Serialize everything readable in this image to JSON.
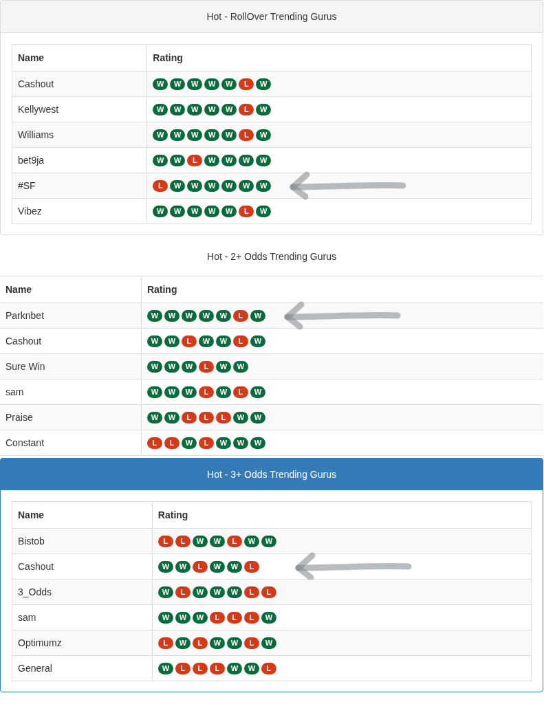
{
  "panels": [
    {
      "title": "Hot - RollOver Trending Gurus",
      "kind": "default",
      "columns": [
        "Name",
        "Rating"
      ],
      "rows": [
        {
          "name": "Cashout",
          "arrow": false,
          "rating": [
            {
              "text": "W",
              "kind": "win"
            },
            {
              "text": "W",
              "kind": "win"
            },
            {
              "text": "W",
              "kind": "win"
            },
            {
              "text": "W",
              "kind": "win"
            },
            {
              "text": "W",
              "kind": "win"
            },
            {
              "text": "L",
              "kind": "loss"
            },
            {
              "text": "W",
              "kind": "win"
            }
          ]
        },
        {
          "name": "Kellywest",
          "arrow": false,
          "rating": [
            {
              "text": "W",
              "kind": "win"
            },
            {
              "text": "W",
              "kind": "win"
            },
            {
              "text": "W",
              "kind": "win"
            },
            {
              "text": "W",
              "kind": "win"
            },
            {
              "text": "W",
              "kind": "win"
            },
            {
              "text": "L",
              "kind": "loss"
            },
            {
              "text": "W",
              "kind": "win"
            }
          ]
        },
        {
          "name": "Williams",
          "arrow": false,
          "rating": [
            {
              "text": "W",
              "kind": "win"
            },
            {
              "text": "W",
              "kind": "win"
            },
            {
              "text": "W",
              "kind": "win"
            },
            {
              "text": "W",
              "kind": "win"
            },
            {
              "text": "W",
              "kind": "win"
            },
            {
              "text": "L",
              "kind": "loss"
            },
            {
              "text": "W",
              "kind": "win"
            }
          ]
        },
        {
          "name": "bet9ja",
          "arrow": false,
          "rating": [
            {
              "text": "W",
              "kind": "win"
            },
            {
              "text": "W",
              "kind": "win"
            },
            {
              "text": "L",
              "kind": "loss"
            },
            {
              "text": "W",
              "kind": "win"
            },
            {
              "text": "W",
              "kind": "win"
            },
            {
              "text": "W",
              "kind": "win"
            },
            {
              "text": "W",
              "kind": "win"
            }
          ]
        },
        {
          "name": "#SF",
          "arrow": true,
          "rating": [
            {
              "text": "L",
              "kind": "loss"
            },
            {
              "text": "W",
              "kind": "win"
            },
            {
              "text": "W",
              "kind": "win"
            },
            {
              "text": "W",
              "kind": "win"
            },
            {
              "text": "W",
              "kind": "win"
            },
            {
              "text": "W",
              "kind": "win"
            },
            {
              "text": "W",
              "kind": "win"
            }
          ]
        },
        {
          "name": "Vibez",
          "arrow": false,
          "rating": [
            {
              "text": "W",
              "kind": "win"
            },
            {
              "text": "W",
              "kind": "win"
            },
            {
              "text": "W",
              "kind": "win"
            },
            {
              "text": "W",
              "kind": "win"
            },
            {
              "text": "W",
              "kind": "win"
            },
            {
              "text": "L",
              "kind": "loss"
            },
            {
              "text": "W",
              "kind": "win"
            }
          ]
        }
      ]
    },
    {
      "title": "Hot - 2+ Odds Trending Gurus",
      "kind": "plain",
      "columns": [
        "Name",
        "Rating"
      ],
      "rows": [
        {
          "name": "Parknbet",
          "arrow": true,
          "rating": [
            {
              "text": "W",
              "kind": "win"
            },
            {
              "text": "W",
              "kind": "win"
            },
            {
              "text": "W",
              "kind": "win"
            },
            {
              "text": "W",
              "kind": "win"
            },
            {
              "text": "W",
              "kind": "win"
            },
            {
              "text": "L",
              "kind": "loss"
            },
            {
              "text": "W",
              "kind": "win"
            }
          ]
        },
        {
          "name": "Cashout",
          "arrow": false,
          "rating": [
            {
              "text": "W",
              "kind": "win"
            },
            {
              "text": "W",
              "kind": "win"
            },
            {
              "text": "L",
              "kind": "loss"
            },
            {
              "text": "W",
              "kind": "win"
            },
            {
              "text": "W",
              "kind": "win"
            },
            {
              "text": "L",
              "kind": "loss"
            },
            {
              "text": "W",
              "kind": "win"
            }
          ]
        },
        {
          "name": "Sure Win",
          "arrow": false,
          "rating": [
            {
              "text": "W",
              "kind": "win"
            },
            {
              "text": "W",
              "kind": "win"
            },
            {
              "text": "W",
              "kind": "win"
            },
            {
              "text": "L",
              "kind": "loss"
            },
            {
              "text": "W",
              "kind": "win"
            },
            {
              "text": "W",
              "kind": "win"
            }
          ]
        },
        {
          "name": "sam",
          "arrow": false,
          "rating": [
            {
              "text": "W",
              "kind": "win"
            },
            {
              "text": "W",
              "kind": "win"
            },
            {
              "text": "W",
              "kind": "win"
            },
            {
              "text": "L",
              "kind": "loss"
            },
            {
              "text": "W",
              "kind": "win"
            },
            {
              "text": "L",
              "kind": "loss"
            },
            {
              "text": "W",
              "kind": "win"
            }
          ]
        },
        {
          "name": "Praise",
          "arrow": false,
          "rating": [
            {
              "text": "W",
              "kind": "win"
            },
            {
              "text": "W",
              "kind": "win"
            },
            {
              "text": "L",
              "kind": "loss"
            },
            {
              "text": "L",
              "kind": "loss"
            },
            {
              "text": "L",
              "kind": "loss"
            },
            {
              "text": "W",
              "kind": "win"
            },
            {
              "text": "W",
              "kind": "win"
            }
          ]
        },
        {
          "name": "Constant",
          "arrow": false,
          "rating": [
            {
              "text": "L",
              "kind": "loss"
            },
            {
              "text": "L",
              "kind": "loss"
            },
            {
              "text": "W",
              "kind": "win"
            },
            {
              "text": "L",
              "kind": "loss"
            },
            {
              "text": "W",
              "kind": "win"
            },
            {
              "text": "W",
              "kind": "win"
            },
            {
              "text": "W",
              "kind": "win"
            }
          ]
        }
      ]
    },
    {
      "title": "Hot - 3+ Odds Trending Gurus",
      "kind": "primary",
      "columns": [
        "Name",
        "Rating"
      ],
      "rows": [
        {
          "name": "Bistob",
          "arrow": false,
          "rating": [
            {
              "text": "L",
              "kind": "loss"
            },
            {
              "text": "L",
              "kind": "loss"
            },
            {
              "text": "W",
              "kind": "win"
            },
            {
              "text": "W",
              "kind": "win"
            },
            {
              "text": "L",
              "kind": "loss"
            },
            {
              "text": "W",
              "kind": "win"
            },
            {
              "text": "W",
              "kind": "win"
            }
          ]
        },
        {
          "name": "Cashout",
          "arrow": true,
          "rating": [
            {
              "text": "W",
              "kind": "win"
            },
            {
              "text": "W",
              "kind": "win"
            },
            {
              "text": "L",
              "kind": "loss"
            },
            {
              "text": "W",
              "kind": "win"
            },
            {
              "text": "W",
              "kind": "win"
            },
            {
              "text": "L",
              "kind": "loss"
            }
          ]
        },
        {
          "name": "3_Odds",
          "arrow": false,
          "rating": [
            {
              "text": "W",
              "kind": "win"
            },
            {
              "text": "L",
              "kind": "loss"
            },
            {
              "text": "W",
              "kind": "win"
            },
            {
              "text": "W",
              "kind": "win"
            },
            {
              "text": "W",
              "kind": "win"
            },
            {
              "text": "L",
              "kind": "loss"
            },
            {
              "text": "L",
              "kind": "loss"
            }
          ]
        },
        {
          "name": "sam",
          "arrow": false,
          "rating": [
            {
              "text": "W",
              "kind": "win"
            },
            {
              "text": "W",
              "kind": "win"
            },
            {
              "text": "W",
              "kind": "win"
            },
            {
              "text": "L",
              "kind": "loss"
            },
            {
              "text": "L",
              "kind": "loss"
            },
            {
              "text": "L",
              "kind": "loss"
            },
            {
              "text": "W",
              "kind": "win"
            }
          ]
        },
        {
          "name": "Optimumz",
          "arrow": false,
          "rating": [
            {
              "text": "L",
              "kind": "loss"
            },
            {
              "text": "W",
              "kind": "win"
            },
            {
              "text": "L",
              "kind": "loss"
            },
            {
              "text": "W",
              "kind": "win"
            },
            {
              "text": "W",
              "kind": "win"
            },
            {
              "text": "L",
              "kind": "loss"
            },
            {
              "text": "W",
              "kind": "win"
            }
          ]
        },
        {
          "name": "General",
          "arrow": false,
          "rating": [
            {
              "text": "W",
              "kind": "win"
            },
            {
              "text": "L",
              "kind": "loss"
            },
            {
              "text": "L",
              "kind": "loss"
            },
            {
              "text": "L",
              "kind": "loss"
            },
            {
              "text": "W",
              "kind": "win"
            },
            {
              "text": "W",
              "kind": "win"
            },
            {
              "text": "L",
              "kind": "loss"
            }
          ]
        }
      ]
    }
  ]
}
